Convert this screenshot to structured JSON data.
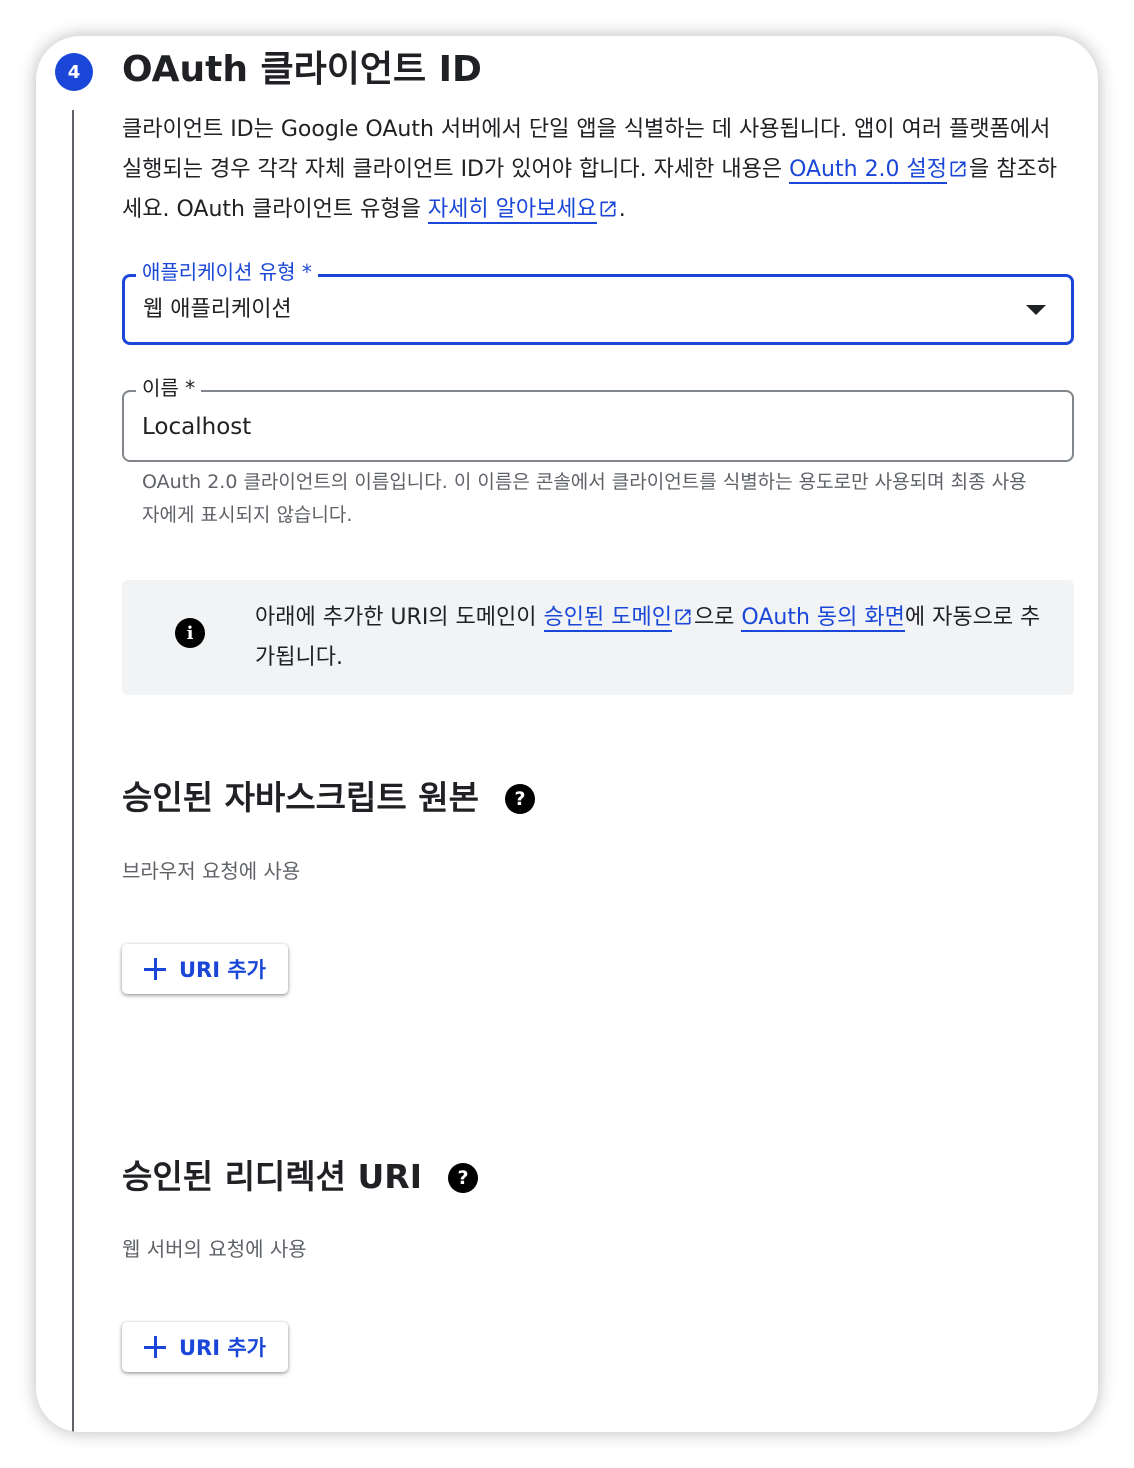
{
  "step": {
    "number": "4",
    "title": "OAuth 클라이언트 ID"
  },
  "description": {
    "text_1": "클라이언트 ID는 Google OAuth 서버에서 단일 앱을 식별하는 데 사용됩니다. 앱이 여러 플랫폼에서 실행되는 경우 각각 자체 클라이언트 ID가 있어야 합니다. 자세한 내용은 ",
    "link_1": "OAuth 2.0 설정",
    "text_2": "을 참조하세요. OAuth 클라이언트 유형을 ",
    "link_2": "자세히 알아보세요",
    "text_3": "."
  },
  "app_type_field": {
    "label": "애플리케이션 유형 *",
    "value": "웹 애플리케이션"
  },
  "name_field": {
    "label": "이름 *",
    "value": "Localhost",
    "helper": "OAuth 2.0 클라이언트의 이름입니다. 이 이름은 콘솔에서 클라이언트를 식별하는 용도로만 사용되며 최종 사용자에게 표시되지 않습니다."
  },
  "info_box": {
    "text_1": "아래에 추가한 URI의 도메인이 ",
    "link_1": "승인된 도메인",
    "text_2": "으로 ",
    "link_2": "OAuth 동의 화면",
    "text_3": "에 자동으로 추가됩니다."
  },
  "js_origins": {
    "title": "승인된 자바스크립트 원본",
    "subtitle": "브라우저 요청에 사용",
    "button": "URI 추가"
  },
  "redirect_uris": {
    "title": "승인된 리디렉션 URI",
    "subtitle": "웹 서버의 요청에 사용",
    "button": "URI 추가"
  },
  "colors": {
    "accent": "#1a47d8",
    "info_background": "#f1f3f4",
    "helper_text": "#5f6368"
  },
  "icons": [
    "open-in-new-icon",
    "info-icon",
    "help-icon",
    "plus-icon",
    "dropdown-arrow-icon"
  ]
}
